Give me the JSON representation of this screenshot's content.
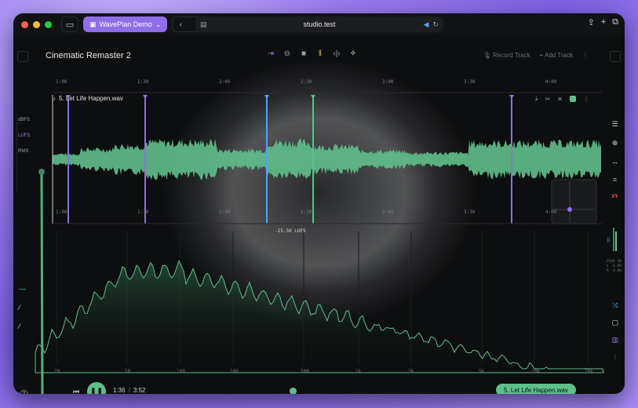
{
  "browser": {
    "workspace_label": "WavePlan Demo",
    "url": "studio.test",
    "traffic_colors": [
      "#ff5f57",
      "#febc2e",
      "#28c840"
    ]
  },
  "app": {
    "title": "Cinematic Remaster 2",
    "record_track": "Record Track",
    "add_track": "Add Track",
    "file_name": "5. Let Life Happen.wav",
    "scales": [
      "dBFS",
      "LUFS",
      "RMS"
    ],
    "active_scale": "LUFS",
    "lufs_readout": "-15.50 LUFS",
    "ruler_top": [
      "1:00",
      "1:30",
      "2:00",
      "2:30",
      "3:00",
      "3:30",
      "4:00"
    ],
    "ruler_bottom": [
      "1:00",
      "1:30",
      "2:00",
      "2:30",
      "3:00",
      "3:30",
      "4:00"
    ],
    "xy_label": "XY",
    "meter_text_1": "PEAK SB",
    "meter_text_2": "L -6.80",
    "meter_text_3": "R -6.80",
    "freq_labels": [
      "20",
      "50",
      "100",
      "200",
      "500",
      "1k",
      "2k",
      "5k",
      "10k",
      "20k"
    ]
  },
  "transport": {
    "current_time": "1:36",
    "separator": "/",
    "total_time": "3:52",
    "now_playing": "5. Let Life Happen.wav"
  },
  "colors": {
    "accent": "#9a7cf0",
    "wave": "#5fbf8a",
    "marker_blue": "#4aa3ff"
  }
}
